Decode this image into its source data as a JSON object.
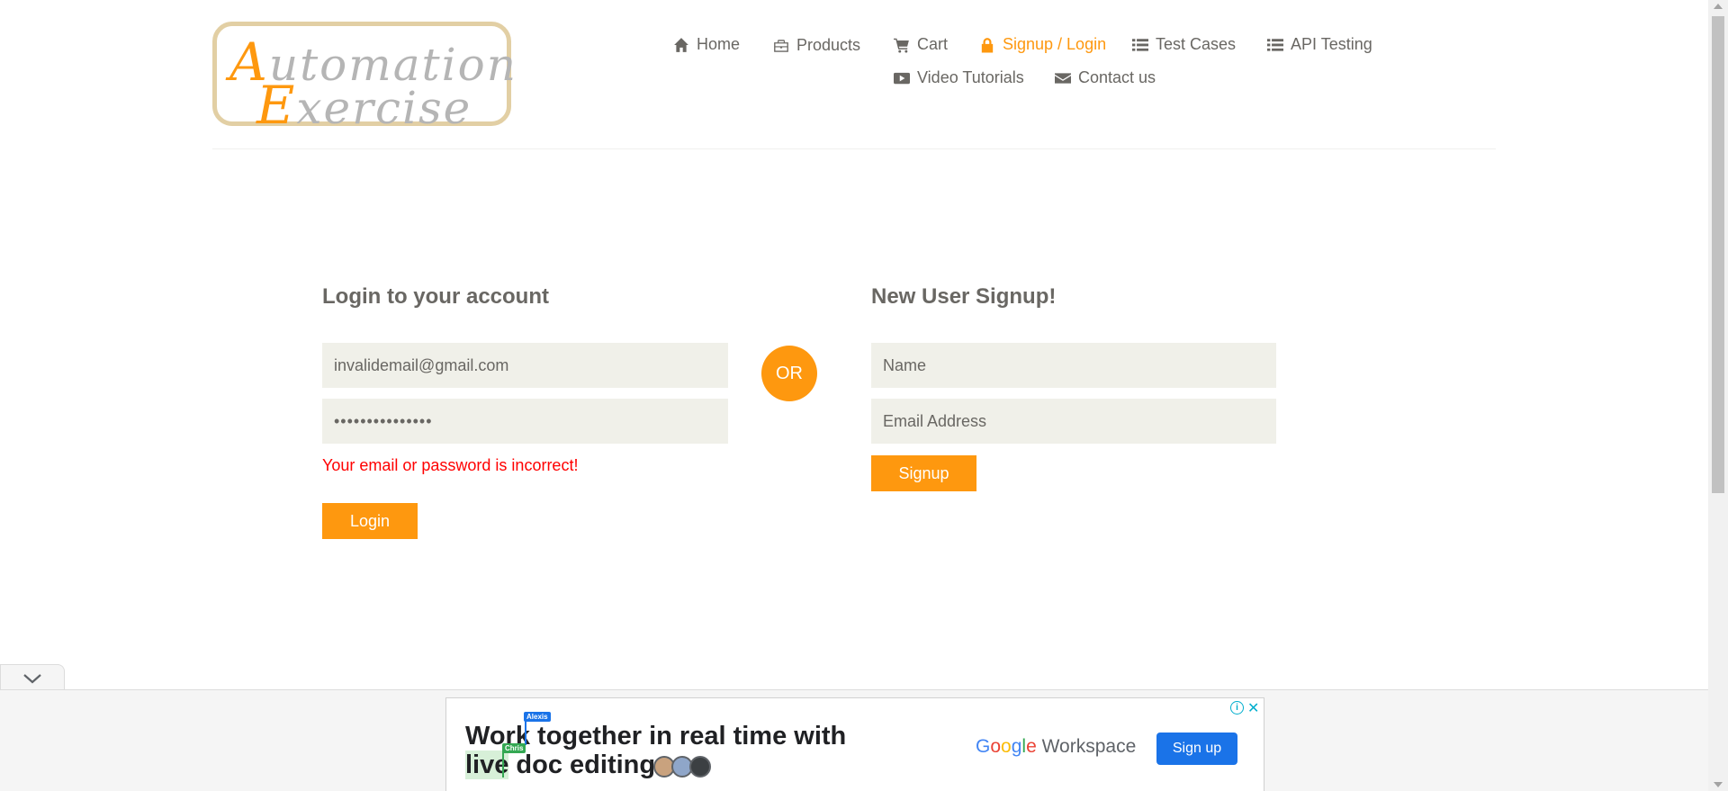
{
  "logo": {
    "line1_cap": "A",
    "line1_rest": "utomation",
    "line2_cap": "E",
    "line2_rest": "xercise"
  },
  "nav": {
    "home": "Home",
    "products": "Products",
    "cart": "Cart",
    "signup_login": "Signup / Login",
    "test_cases": "Test Cases",
    "api_testing": "API Testing",
    "video_tutorials": "Video Tutorials",
    "contact_us": "Contact us"
  },
  "login": {
    "title": "Login to your account",
    "email_value": "invalidemail@gmail.com",
    "password_value": "•••••••••••••••",
    "error": "Your email or password is incorrect!",
    "button": "Login"
  },
  "or_label": "OR",
  "signup": {
    "title": "New User Signup!",
    "name_placeholder": "Name",
    "email_placeholder": "Email Address",
    "button": "Signup"
  },
  "ad": {
    "line1_a": "Work",
    "line1_b": " together in real time with",
    "line2_a": "live",
    "line2_b": " doc editing.",
    "tag_blue": "Alexis",
    "tag_green": "Chris",
    "brand_g": "G",
    "brand_o1": "o",
    "brand_o2": "o",
    "brand_g2": "g",
    "brand_l": "l",
    "brand_e": "e",
    "brand_suffix": " Workspace",
    "button": "Sign up",
    "info": "i",
    "close": "✕"
  },
  "colors": {
    "accent": "#fe980f",
    "error": "#ff0000",
    "input_bg": "#f0f0e9",
    "text": "#696763",
    "ad_blue": "#1a73e8"
  },
  "icons": {
    "home": "home-icon",
    "products": "briefcase-icon",
    "cart": "cart-icon",
    "login": "lock-icon",
    "test_cases": "list-icon",
    "api": "list-icon",
    "video": "youtube-play-icon",
    "contact": "envelope-icon"
  }
}
